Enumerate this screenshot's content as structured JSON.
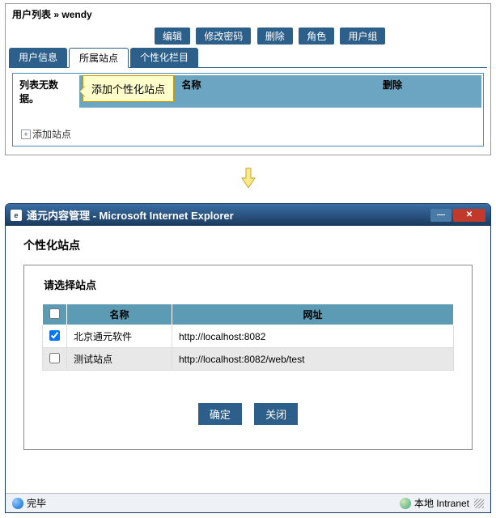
{
  "breadcrumb": {
    "list_label": "用户列表",
    "sep": " » ",
    "user": "wendy"
  },
  "actions": {
    "edit": "编辑",
    "change_pw": "修改密码",
    "delete": "删除",
    "role": "角色",
    "group": "用户组"
  },
  "tabs": {
    "info": "用户信息",
    "sites": "所属站点",
    "columns": "个性化栏目"
  },
  "grid": {
    "no_data_label": "列表无数据。",
    "col_name": "名称",
    "col_delete": "删除"
  },
  "callout": {
    "text": "添加个性化站点"
  },
  "add_link": {
    "label": "添加站点"
  },
  "ie": {
    "title": "通元内容管理 - Microsoft Internet Explorer",
    "section_title": "个性化站点",
    "legend": "请选择站点",
    "col_name": "名称",
    "col_url": "网址",
    "rows": [
      {
        "checked": true,
        "name": "北京通元软件",
        "url": "http://localhost:8082"
      },
      {
        "checked": false,
        "name": "测试站点",
        "url": "http://localhost:8082/web/test"
      }
    ],
    "ok": "确定",
    "close": "关闭",
    "status_done": "完毕",
    "zone": "本地 Intranet"
  }
}
